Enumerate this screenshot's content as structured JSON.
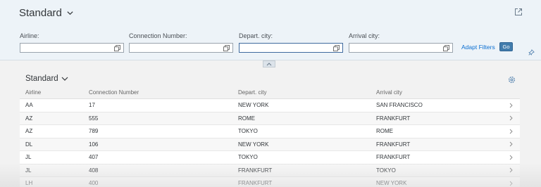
{
  "header": {
    "variant": "Standard"
  },
  "filters": [
    {
      "label": "Airline:",
      "value": ""
    },
    {
      "label": "Connection Number:",
      "value": ""
    },
    {
      "label": "Depart. city:",
      "value": ""
    },
    {
      "label": "Arrival city:",
      "value": ""
    }
  ],
  "actions": {
    "adapt_filters": "Adapt Filters",
    "go": "Go"
  },
  "table": {
    "variant": "Standard",
    "columns": [
      "Airline",
      "Connection Number",
      "Depart. city",
      "Arrival city"
    ],
    "rows": [
      [
        "AA",
        "17",
        "NEW YORK",
        "SAN FRANCISCO"
      ],
      [
        "AZ",
        "555",
        "ROME",
        "FRANKFURT"
      ],
      [
        "AZ",
        "789",
        "TOKYO",
        "ROME"
      ],
      [
        "DL",
        "106",
        "NEW YORK",
        "FRANKFURT"
      ],
      [
        "JL",
        "407",
        "TOKYO",
        "FRANKFURT"
      ],
      [
        "JL",
        "408",
        "FRANKFURT",
        "TOKYO"
      ],
      [
        "LH",
        "400",
        "FRANKFURT",
        "NEW YORK"
      ]
    ]
  },
  "icons": {
    "variant_toggle": "chevron-down-icon",
    "share": "share-icon",
    "value_help": "value-help-icon",
    "pin": "pin-icon",
    "collapse": "chevron-up-icon",
    "settings": "gear-icon",
    "row_nav": "chevron-right-icon"
  }
}
